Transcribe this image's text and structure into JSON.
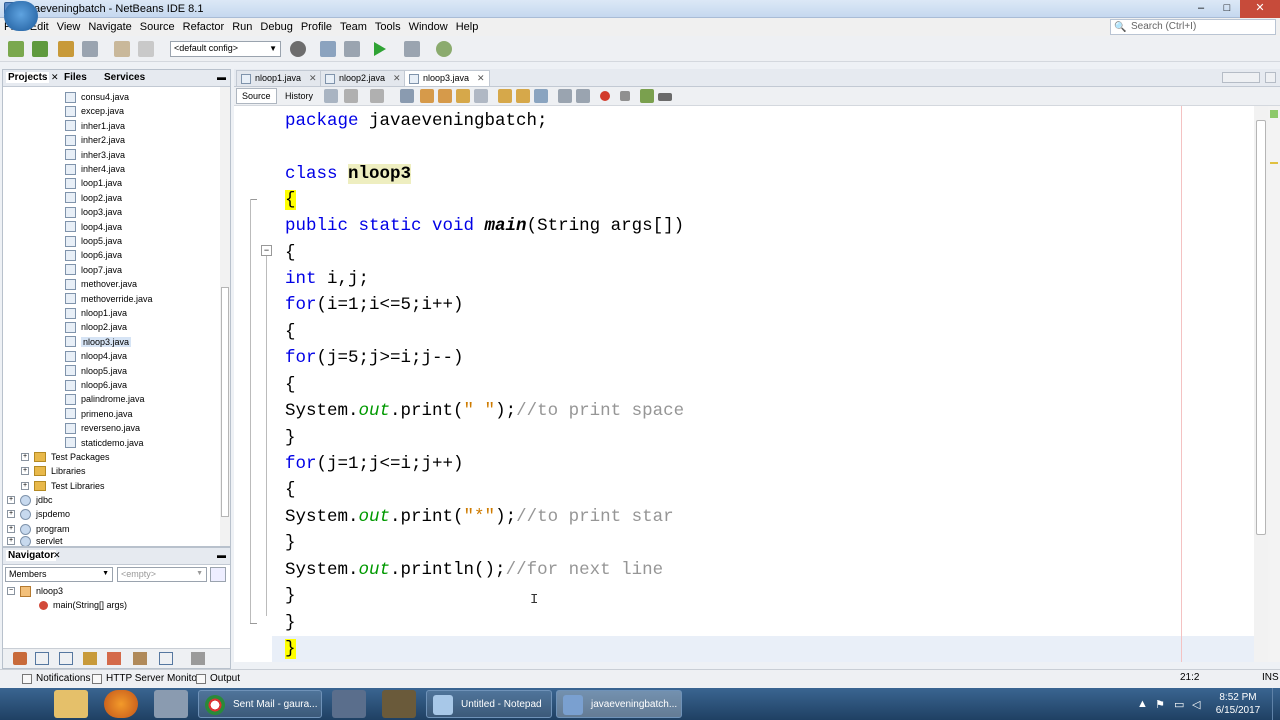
{
  "window": {
    "title": "javaeveningbatch - NetBeans IDE 8.1",
    "controls": [
      "–",
      "□",
      "✕"
    ]
  },
  "menu": [
    "File",
    "Edit",
    "View",
    "Navigate",
    "Source",
    "Refactor",
    "Run",
    "Debug",
    "Profile",
    "Team",
    "Tools",
    "Window",
    "Help"
  ],
  "search": {
    "placeholder": "Search (Ctrl+I)"
  },
  "toolbar": {
    "config_value": "<default config>"
  },
  "projects_pane": {
    "tabs": [
      "Projects",
      "Files",
      "Services"
    ],
    "files": [
      "consu4.java",
      "excep.java",
      "inher1.java",
      "inher2.java",
      "inher3.java",
      "inher4.java",
      "loop1.java",
      "loop2.java",
      "loop3.java",
      "loop4.java",
      "loop5.java",
      "loop6.java",
      "loop7.java",
      "methover.java",
      "methoverride.java",
      "nloop1.java",
      "nloop2.java",
      "nloop3.java",
      "nloop4.java",
      "nloop5.java",
      "nloop6.java",
      "palindrome.java",
      "primeno.java",
      "reverseno.java",
      "staticdemo.java"
    ],
    "selected_file": "nloop3.java",
    "folders": [
      "Test Packages",
      "Libraries",
      "Test Libraries"
    ],
    "projects": [
      "jdbc",
      "jspdemo",
      "program",
      "servlet"
    ]
  },
  "navigator": {
    "title": "Navigator",
    "members_label": "Members",
    "filter_placeholder": "<empty>",
    "class_name": "nloop3",
    "method": "main(String[] args)"
  },
  "editor": {
    "tabs": [
      "nloop1.java",
      "nloop2.java",
      "nloop3.java"
    ],
    "active_tab": "nloop3.java",
    "modes": [
      "Source",
      "History"
    ],
    "position": "21:2",
    "insert_mode": "INS"
  },
  "output_bar": [
    "Notifications",
    "HTTP Server Monitor",
    "Output"
  ],
  "taskbar": {
    "tasks": [
      "Sent Mail - gaura...",
      "Untitled - Notepad",
      "javaeveningbatch..."
    ],
    "time": "8:52 PM",
    "date": "6/15/2017"
  }
}
